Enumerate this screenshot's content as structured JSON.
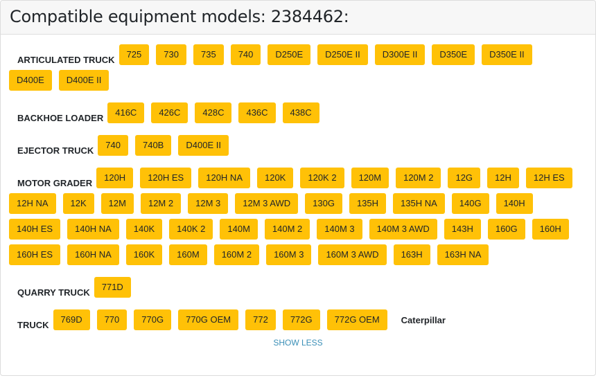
{
  "header": {
    "title": "Compatible equipment models: 2384462:"
  },
  "categories": [
    {
      "name": "ARTICULATED TRUCK",
      "models": [
        "725",
        "730",
        "735",
        "740",
        "D250E",
        "D250E II",
        "D300E II",
        "D350E",
        "D350E II",
        "D400E",
        "D400E II"
      ]
    },
    {
      "name": "BACKHOE LOADER",
      "models": [
        "416C",
        "426C",
        "428C",
        "436C",
        "438C"
      ]
    },
    {
      "name": "EJECTOR TRUCK",
      "models": [
        "740",
        "740B",
        "D400E II"
      ]
    },
    {
      "name": "MOTOR GRADER",
      "models": [
        "120H",
        "120H ES",
        "120H NA",
        "120K",
        "120K 2",
        "120M",
        "120M 2",
        "12G",
        "12H",
        "12H ES",
        "12H NA",
        "12K",
        "12M",
        "12M 2",
        "12M 3",
        "12M 3 AWD",
        "130G",
        "135H",
        "135H NA",
        "140G",
        "140H",
        "140H ES",
        "140H NA",
        "140K",
        "140K 2",
        "140M",
        "140M 2",
        "140M 3",
        "140M 3 AWD",
        "143H",
        "160G",
        "160H",
        "160H ES",
        "160H NA",
        "160K",
        "160M",
        "160M 2",
        "160M 3",
        "160M 3 AWD",
        "163H",
        "163H NA"
      ]
    },
    {
      "name": "QUARRY TRUCK",
      "models": [
        "771D"
      ]
    },
    {
      "name": "TRUCK",
      "models": [
        "769D",
        "770",
        "770G",
        "770G OEM",
        "772",
        "772G",
        "772G OEM"
      ]
    }
  ],
  "brand": "Caterpillar",
  "show_less_label": "SHOW LESS",
  "colors": {
    "chip": "#ffc107",
    "link": "#3a8fb7"
  }
}
